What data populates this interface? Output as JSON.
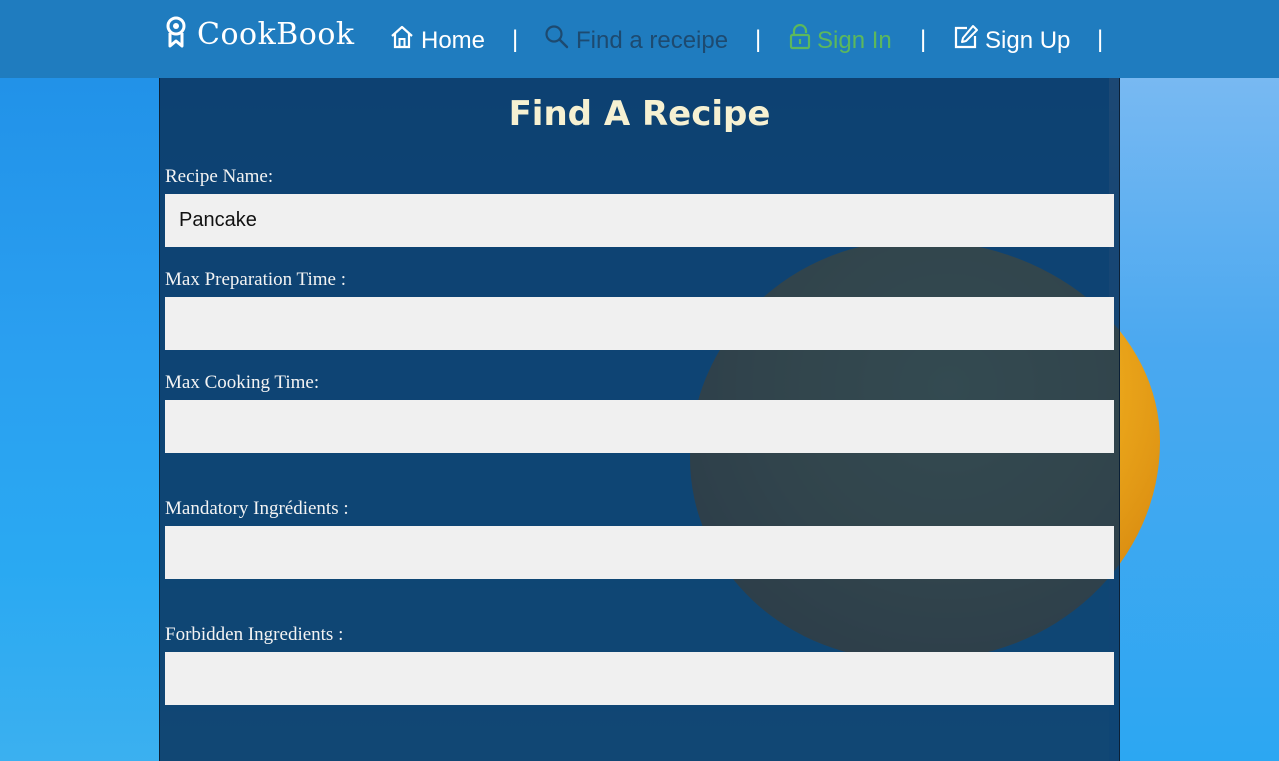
{
  "navbar": {
    "brand": {
      "icon": "award-ribbon-icon",
      "name": "CookBook"
    },
    "items": [
      {
        "icon": "home-icon",
        "label": "Home"
      },
      {
        "icon": "search-icon",
        "label": "Find a receipe",
        "color": "#1d4a70"
      },
      {
        "icon": "lock-icon",
        "label": "Sign In",
        "color": "#5cb85c"
      },
      {
        "icon": "edit-icon",
        "label": "Sign Up"
      }
    ],
    "separator": "|",
    "background": "#1f7cbf"
  },
  "form": {
    "title": "Find A Recipe",
    "fields": [
      {
        "label": "Recipe Name:",
        "value": "Pancake"
      },
      {
        "label": "Max Preparation Time :",
        "value": ""
      },
      {
        "label": "Max Cooking Time:",
        "value": ""
      },
      {
        "label": "Mandatory Ingrédients :",
        "value": ""
      },
      {
        "label": "Forbidden Ingredients :",
        "value": ""
      }
    ]
  },
  "colors": {
    "title": "#f6f1d2",
    "panel": "#083058",
    "input_bg": "#f0f0f0"
  }
}
